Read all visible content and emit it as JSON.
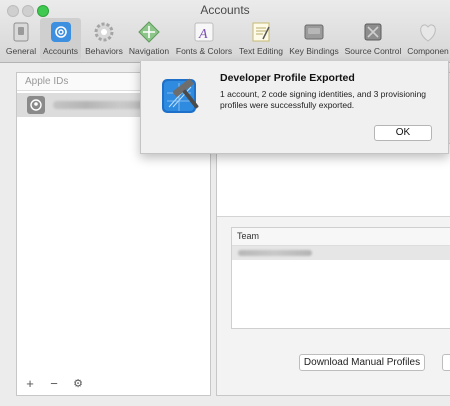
{
  "window": {
    "title": "Accounts"
  },
  "toolbar": {
    "items": [
      {
        "label": "General",
        "icon": "general-icon"
      },
      {
        "label": "Accounts",
        "icon": "accounts-at-icon",
        "selected": true
      },
      {
        "label": "Behaviors",
        "icon": "behaviors-gear-icon"
      },
      {
        "label": "Navigation",
        "icon": "navigation-arrows-icon"
      },
      {
        "label": "Fonts & Colors",
        "icon": "fonts-colors-icon"
      },
      {
        "label": "Text Editing",
        "icon": "text-editing-icon"
      },
      {
        "label": "Key Bindings",
        "icon": "key-bindings-icon"
      },
      {
        "label": "Source Control",
        "icon": "source-control-icon"
      },
      {
        "label": "Componen",
        "icon": "components-icon"
      }
    ]
  },
  "accounts_list": {
    "header": "Apple IDs",
    "footer": {
      "add": "+",
      "remove": "−",
      "settings": "⚙"
    }
  },
  "details": {
    "team_header": "Team",
    "download_button": "Download Manual Profiles"
  },
  "dialog": {
    "title": "Developer Profile Exported",
    "message": "1 account, 2 code signing identities, and 3 provisioning profiles were successfully exported.",
    "ok_label": "OK",
    "icon": "xcode-hammer-icon"
  }
}
